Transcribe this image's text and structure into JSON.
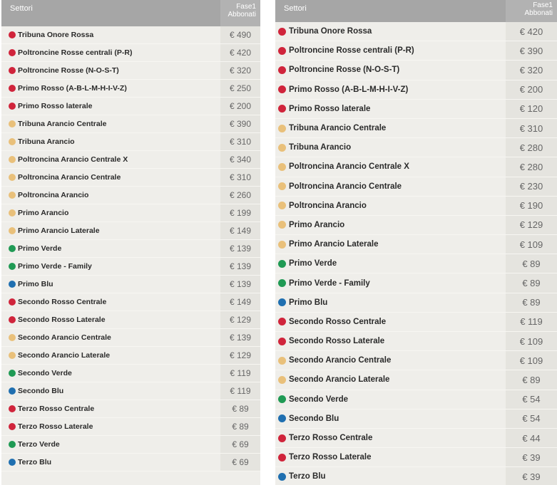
{
  "colors": {
    "red": "#d0243b",
    "orange": "#e9c07a",
    "green": "#1f9a54",
    "blue": "#1f6fb0"
  },
  "left_table": {
    "header": {
      "sectors_label": "Settori",
      "price_label_line1": "Fase1",
      "price_label_line2": "Abbonati"
    },
    "rows": [
      {
        "sector": "Tribuna Onore Rossa",
        "color": "red",
        "price": "€ 490"
      },
      {
        "sector": "Poltroncine Rosse centrali (P-R)",
        "color": "red",
        "price": "€ 420"
      },
      {
        "sector": "Poltroncine Rosse (N-O-S-T)",
        "color": "red",
        "price": "€ 320"
      },
      {
        "sector": "Primo Rosso (A-B-L-M-H-I-V-Z)",
        "color": "red",
        "price": "€ 250"
      },
      {
        "sector": "Primo Rosso laterale",
        "color": "red",
        "price": "€ 200"
      },
      {
        "sector": "Tribuna Arancio Centrale",
        "color": "orange",
        "price": "€ 390"
      },
      {
        "sector": "Tribuna Arancio",
        "color": "orange",
        "price": "€ 310"
      },
      {
        "sector": "Poltroncina Arancio Centrale X",
        "color": "orange",
        "price": "€ 340"
      },
      {
        "sector": "Poltroncina Arancio Centrale",
        "color": "orange",
        "price": "€ 310"
      },
      {
        "sector": "Poltroncina Arancio",
        "color": "orange",
        "price": "€ 260"
      },
      {
        "sector": "Primo Arancio",
        "color": "orange",
        "price": "€ 199"
      },
      {
        "sector": "Primo Arancio Laterale",
        "color": "orange",
        "price": "€ 149"
      },
      {
        "sector": "Primo Verde",
        "color": "green",
        "price": "€ 139"
      },
      {
        "sector": "Primo Verde - Family",
        "color": "green",
        "price": "€ 139"
      },
      {
        "sector": "Primo Blu",
        "color": "blue",
        "price": "€ 139"
      },
      {
        "sector": "Secondo Rosso Centrale",
        "color": "red",
        "price": "€ 149"
      },
      {
        "sector": "Secondo Rosso Laterale",
        "color": "red",
        "price": "€ 129"
      },
      {
        "sector": "Secondo Arancio Centrale",
        "color": "orange",
        "price": "€ 139"
      },
      {
        "sector": "Secondo Arancio Laterale",
        "color": "orange",
        "price": "€ 129"
      },
      {
        "sector": "Secondo Verde",
        "color": "green",
        "price": "€ 119"
      },
      {
        "sector": "Secondo Blu",
        "color": "blue",
        "price": "€ 119"
      },
      {
        "sector": "Terzo Rosso Centrale",
        "color": "red",
        "price": "€ 89"
      },
      {
        "sector": "Terzo Rosso Laterale",
        "color": "red",
        "price": "€ 89"
      },
      {
        "sector": "Terzo Verde",
        "color": "green",
        "price": "€ 69"
      },
      {
        "sector": "Terzo Blu",
        "color": "blue",
        "price": "€ 69"
      }
    ]
  },
  "right_table": {
    "header": {
      "sectors_label": "Settori",
      "price_label_line1": "Fase1",
      "price_label_line2": "Abbonati"
    },
    "rows": [
      {
        "sector": "Tribuna Onore Rossa",
        "color": "red",
        "price": "€ 420"
      },
      {
        "sector": "Poltroncine Rosse centrali (P-R)",
        "color": "red",
        "price": "€ 390"
      },
      {
        "sector": "Poltroncine Rosse (N-O-S-T)",
        "color": "red",
        "price": "€ 320"
      },
      {
        "sector": "Primo Rosso (A-B-L-M-H-I-V-Z)",
        "color": "red",
        "price": "€ 200"
      },
      {
        "sector": "Primo Rosso laterale",
        "color": "red",
        "price": "€ 120"
      },
      {
        "sector": "Tribuna Arancio Centrale",
        "color": "orange",
        "price": "€ 310"
      },
      {
        "sector": "Tribuna Arancio",
        "color": "orange",
        "price": "€ 280"
      },
      {
        "sector": "Poltroncina Arancio Centrale X",
        "color": "orange",
        "price": "€ 280"
      },
      {
        "sector": "Poltroncina Arancio Centrale",
        "color": "orange",
        "price": "€ 230"
      },
      {
        "sector": "Poltroncina Arancio",
        "color": "orange",
        "price": "€ 190"
      },
      {
        "sector": "Primo Arancio",
        "color": "orange",
        "price": "€ 129"
      },
      {
        "sector": "Primo Arancio Laterale",
        "color": "orange",
        "price": "€ 109"
      },
      {
        "sector": "Primo Verde",
        "color": "green",
        "price": "€ 89"
      },
      {
        "sector": "Primo Verde - Family",
        "color": "green",
        "price": "€ 89"
      },
      {
        "sector": "Primo Blu",
        "color": "blue",
        "price": "€ 89"
      },
      {
        "sector": "Secondo Rosso Centrale",
        "color": "red",
        "price": "€ 119"
      },
      {
        "sector": "Secondo Rosso Laterale",
        "color": "red",
        "price": "€ 109"
      },
      {
        "sector": "Secondo Arancio Centrale",
        "color": "orange",
        "price": "€ 109"
      },
      {
        "sector": "Secondo Arancio Laterale",
        "color": "orange",
        "price": "€ 89"
      },
      {
        "sector": "Secondo Verde",
        "color": "green",
        "price": "€ 54"
      },
      {
        "sector": "Secondo Blu",
        "color": "blue",
        "price": "€ 54"
      },
      {
        "sector": "Terzo Rosso Centrale",
        "color": "red",
        "price": "€ 44"
      },
      {
        "sector": "Terzo Rosso Laterale",
        "color": "red",
        "price": "€ 39"
      },
      {
        "sector": "Terzo Blu",
        "color": "blue",
        "price": "€ 39"
      }
    ]
  }
}
